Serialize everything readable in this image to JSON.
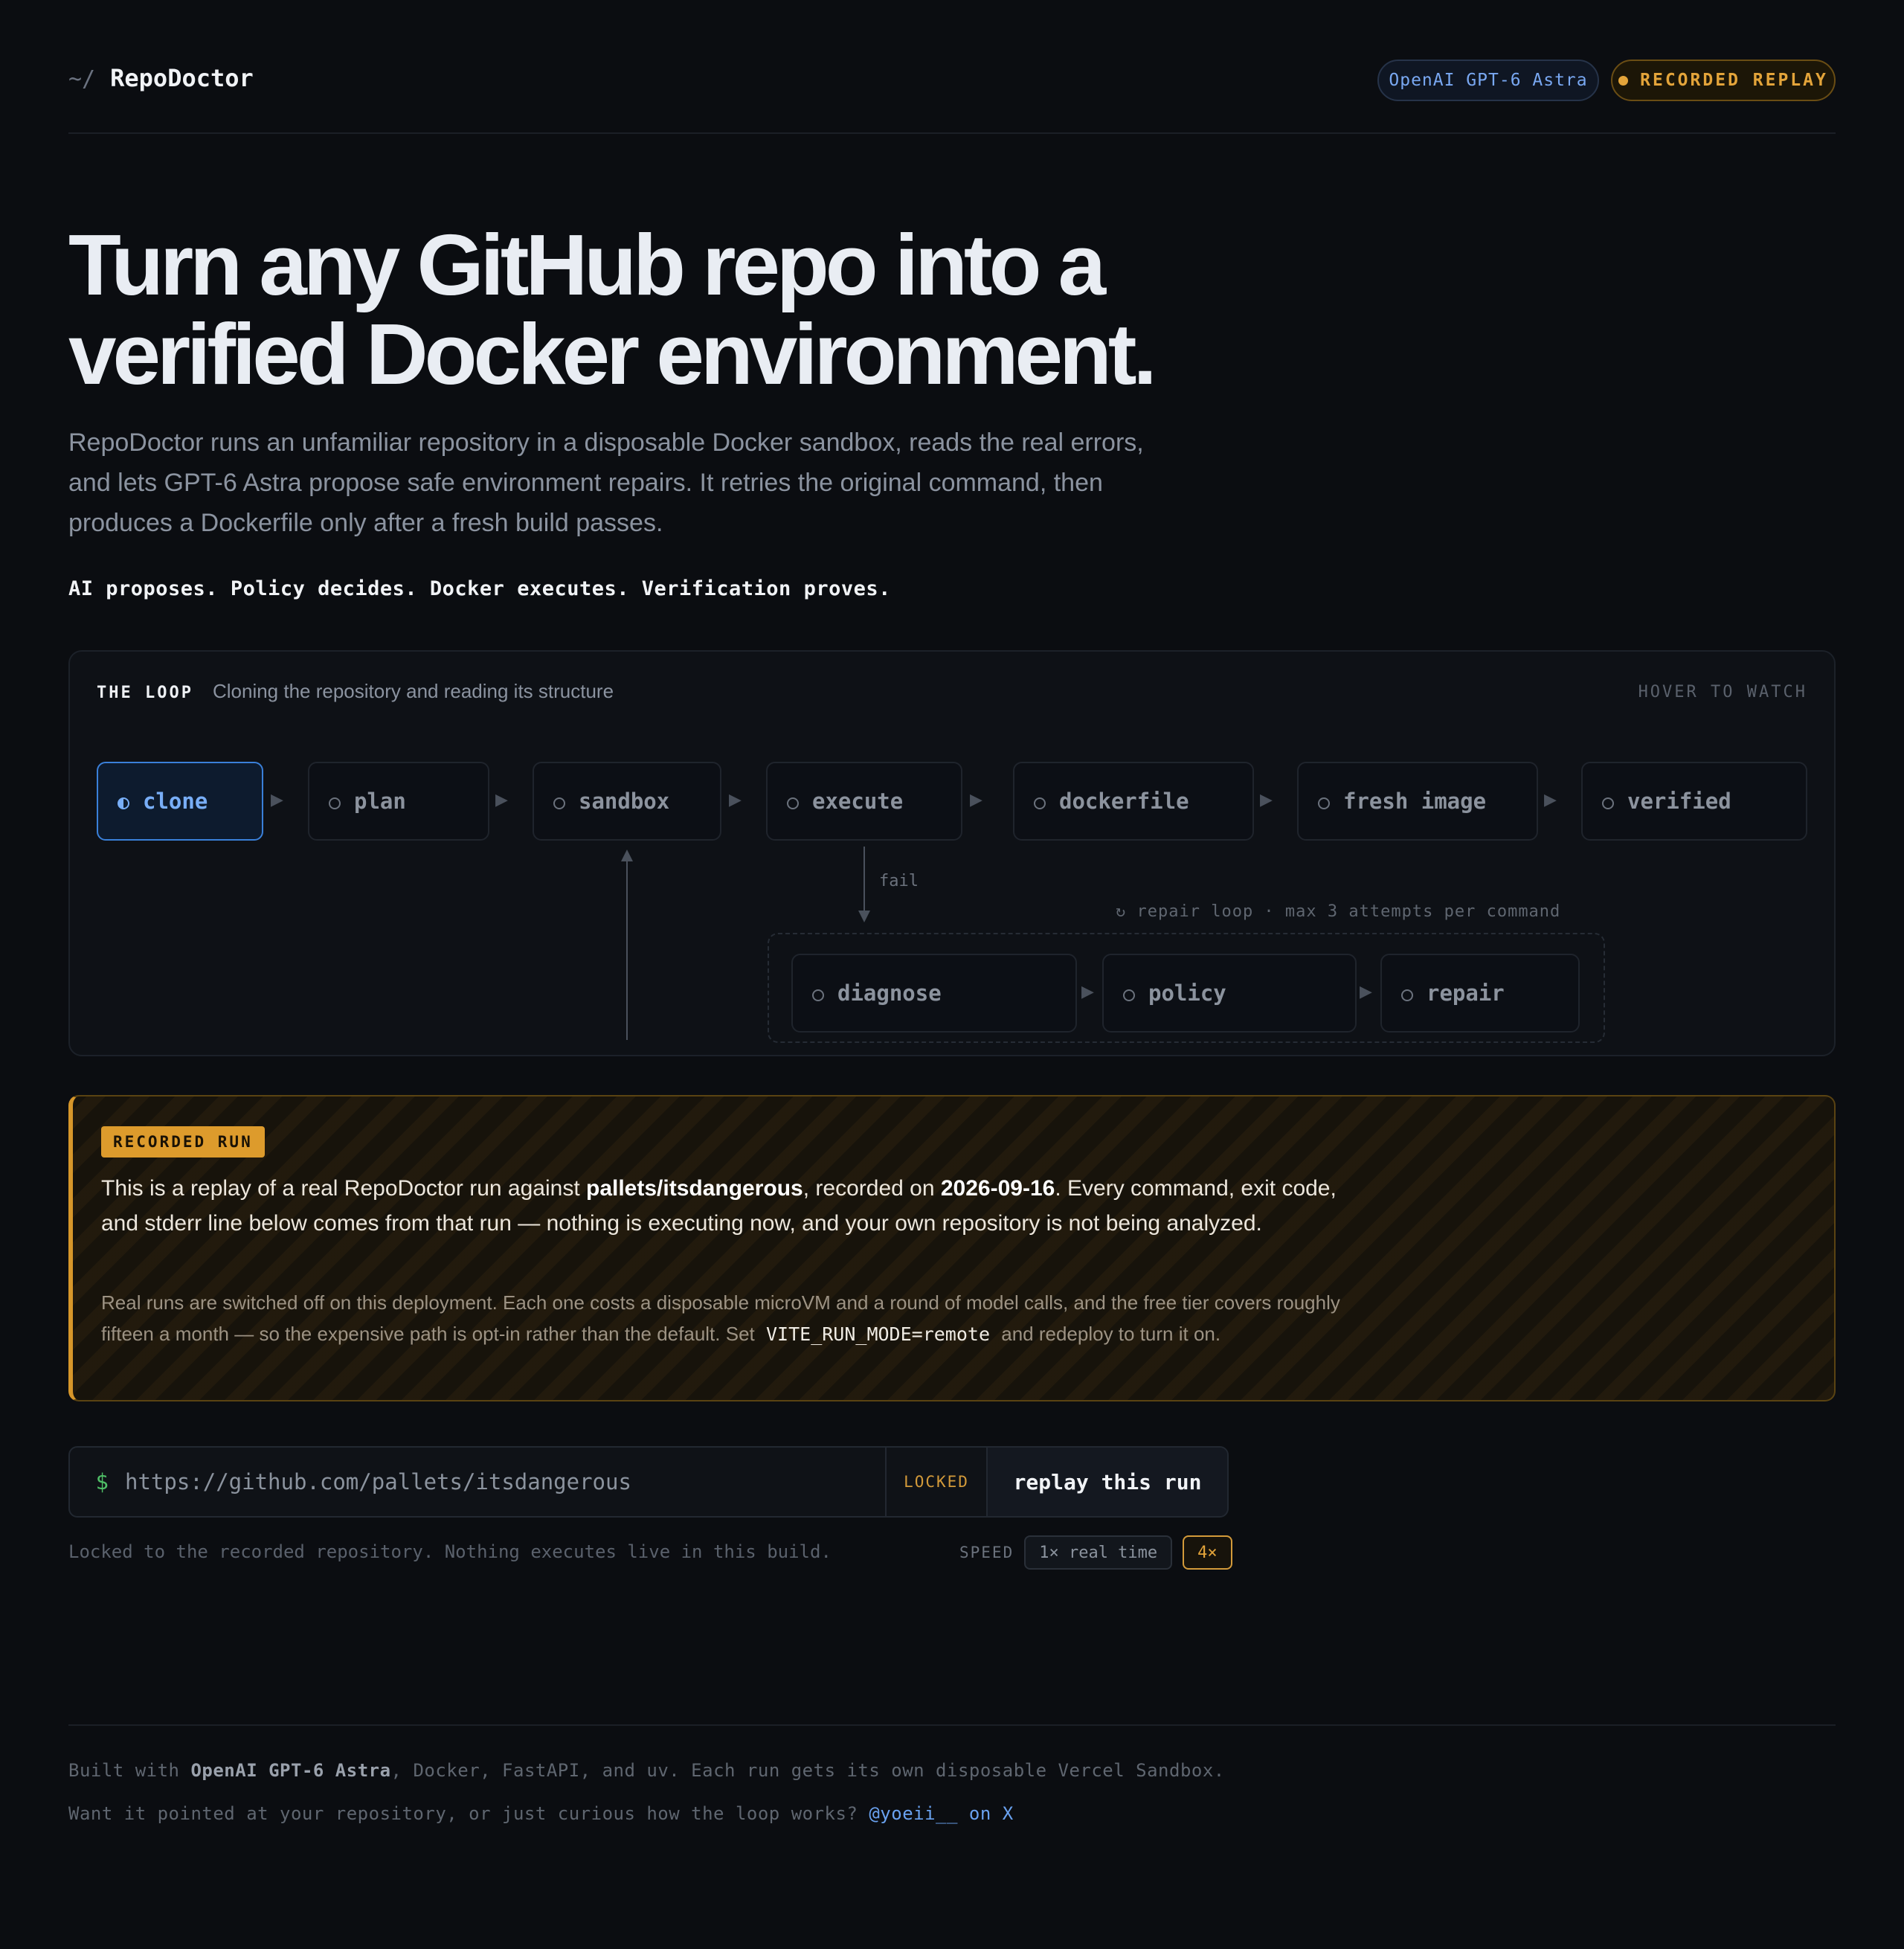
{
  "header": {
    "tilde": "~/",
    "brand": "RepoDoctor",
    "model_badge": "OpenAI GPT-6 Astra",
    "replay_badge": "RECORDED REPLAY"
  },
  "hero": {
    "title": "Turn any GitHub repo into a verified Docker environment.",
    "subtitle": "RepoDoctor runs an unfamiliar repository in a disposable Docker sandbox, reads the real errors, and lets GPT-6 Astra propose safe environment repairs. It retries the original command, then produces a Dockerfile only after a fresh build passes.",
    "tagline": "AI proposes. Policy decides. Docker executes. Verification proves."
  },
  "loop": {
    "label": "THE LOOP",
    "status": "Cloning the repository and reading its structure",
    "hint": "HOVER TO WATCH",
    "stages": [
      "clone",
      "plan",
      "sandbox",
      "execute",
      "dockerfile",
      "fresh image",
      "verified"
    ],
    "active_stage": "clone",
    "fail_label": "fail",
    "repair_label": "↻ repair loop · max 3 attempts per command",
    "repair_stages": [
      "diagnose",
      "policy",
      "repair"
    ],
    "arrow": "▶"
  },
  "recorded": {
    "tag": "RECORDED RUN",
    "intro": "This is a replay of a real RepoDoctor run against ",
    "repo": "pallets/itsdangerous",
    "mid": ", recorded on ",
    "date": "2026-09-16",
    "rest": ". Every command, exit code, and stderr line below comes from that run — nothing is executing now, and your own repository is not being analyzed.",
    "note_before": "Real runs are switched off on this deployment. Each one costs a disposable microVM and a round of model calls, and the free tier covers roughly fifteen a month — so the expensive path is opt-in rather than the default. Set ",
    "note_code": "VITE_RUN_MODE=remote",
    "note_after": " and redeploy to turn it on."
  },
  "input": {
    "prompt": "$",
    "value": "https://github.com/pallets/itsdangerous",
    "locked": "LOCKED",
    "button": "replay this run",
    "help": "Locked to the recorded repository. Nothing executes live in this build."
  },
  "speed": {
    "label": "SPEED",
    "options": [
      "1× real time",
      "4×"
    ],
    "selected": "4×"
  },
  "footer": {
    "l1_pre": "Built with ",
    "l1_bold": "OpenAI GPT-6 Astra",
    "l1_post": ", Docker, FastAPI, and uv. Each run gets its own disposable Vercel Sandbox.",
    "l2_pre": "Want it pointed at your repository, or just curious how the loop works? ",
    "l2_link": "@yoeii__ on X"
  },
  "colors": {
    "background": "#0b0d11",
    "accent_blue": "#78aef7",
    "accent_amber": "#e3a43a",
    "prompt_green": "#4fbf67"
  }
}
